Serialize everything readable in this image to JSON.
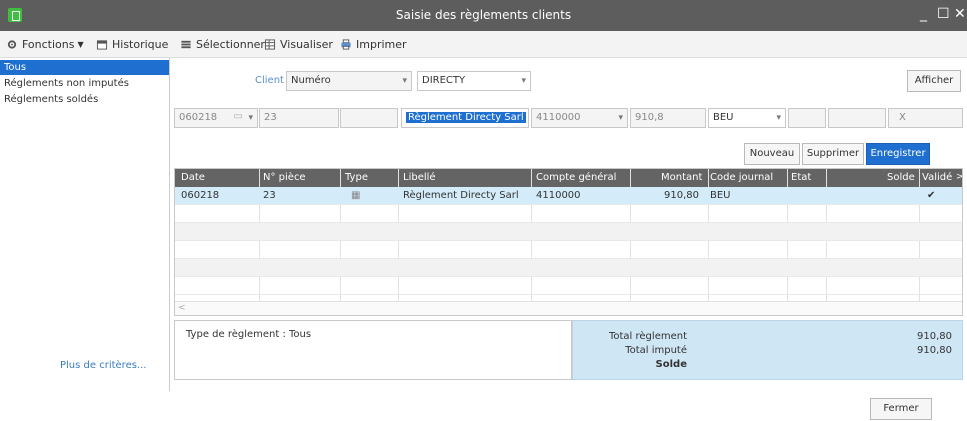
{
  "window": {
    "title": "Saisie des règlements clients",
    "minimize": "_",
    "maximize": "☐",
    "close": "✕"
  },
  "toolbar": {
    "fonctions": "Fonctions",
    "historique": "Historique",
    "selectionner": "Sélectionner",
    "visualiser": "Visualiser",
    "imprimer": "Imprimer"
  },
  "sidebar": {
    "items": [
      {
        "label": "Tous",
        "selected": true
      },
      {
        "label": "Réglements non imputés",
        "selected": false
      },
      {
        "label": "Réglements soldés",
        "selected": false
      }
    ],
    "more_criteria": "Plus de critères..."
  },
  "criteria": {
    "client_label": "Client",
    "client_field": "Numéro",
    "client_value": "DIRECTY",
    "afficher": "Afficher"
  },
  "entry": {
    "date": "060218",
    "piece": "23",
    "libelle": "Règlement Directy Sarl",
    "compte": "4110000",
    "montant": "910,8",
    "journal": "BEU",
    "x": "X",
    "nouveau": "Nouveau",
    "supprimer": "Supprimer",
    "enregistrer": "Enregistrer"
  },
  "grid": {
    "headers": {
      "date": "Date",
      "piece": "N° pièce",
      "type": "Type",
      "libelle": "Libellé",
      "compte": "Compte général",
      "montant": "Montant",
      "journal": "Code journal",
      "etat": "Etat",
      "solde": "Solde",
      "valide": "Validé"
    },
    "rows": [
      {
        "date": "060218",
        "piece": "23",
        "type": "▦",
        "libelle": "Règlement Directy Sarl",
        "compte": "4110000",
        "montant": "910,80",
        "journal": "BEU",
        "etat": "",
        "solde": "",
        "valide": "✔"
      }
    ]
  },
  "footer": {
    "type_reglement": "Type de règlement : Tous",
    "total_reglement_label": "Total règlement",
    "total_impute_label": "Total imputé",
    "solde_label": "Solde",
    "total_reglement": "910,80",
    "total_impute": "910,80"
  },
  "fermer": "Fermer",
  "colors": {
    "titlebar": "#5d5d5d",
    "accent": "#1e6fd0",
    "grid_header": "#646464",
    "totals_bg": "#cfe6f4"
  }
}
